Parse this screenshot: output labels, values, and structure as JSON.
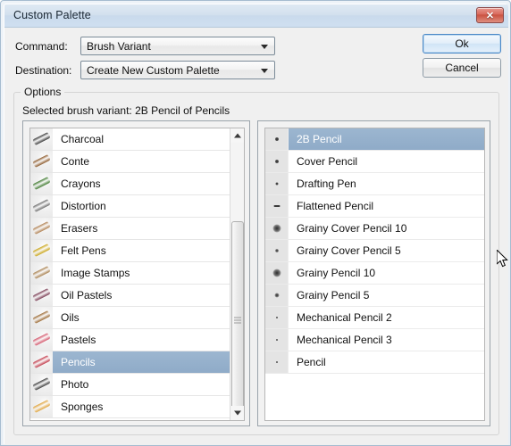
{
  "window": {
    "title": "Custom Palette",
    "close_icon": "close-x-icon",
    "close_label": "✕"
  },
  "form": {
    "command_label": "Command:",
    "command_value": "Brush Variant",
    "destination_label": "Destination:",
    "destination_value": "Create New Custom Palette"
  },
  "buttons": {
    "ok_label": "Ok",
    "cancel_label": "Cancel"
  },
  "options": {
    "group_title": "Options",
    "selected_variant_text": "Selected brush variant: 2B Pencil of Pencils"
  },
  "category_list": {
    "selected": "Pencils",
    "items": [
      {
        "label": "Charcoal",
        "thumb": "#3a3a3a"
      },
      {
        "label": "Conte",
        "thumb": "#8d5a2b"
      },
      {
        "label": "Crayons",
        "thumb": "#3f7a2e"
      },
      {
        "label": "Distortion",
        "thumb": "#6e6e6e"
      },
      {
        "label": "Erasers",
        "thumb": "#b08050"
      },
      {
        "label": "Felt Pens",
        "thumb": "#caa518"
      },
      {
        "label": "Image Stamps",
        "thumb": "#a9814f"
      },
      {
        "label": "Oil Pastels",
        "thumb": "#7a3b52"
      },
      {
        "label": "Oils",
        "thumb": "#9c6a33"
      },
      {
        "label": "Pastels",
        "thumb": "#d4556a"
      },
      {
        "label": "Pencils",
        "thumb": "#c23a4a"
      },
      {
        "label": "Photo",
        "thumb": "#3c3c3c"
      },
      {
        "label": "Sponges",
        "thumb": "#e0a43c"
      }
    ],
    "scrollbar": {
      "up_icon": "scroll-up-arrow-icon",
      "down_icon": "scroll-down-arrow-icon"
    }
  },
  "variant_list": {
    "selected": "2B Pencil",
    "items": [
      {
        "label": "2B Pencil",
        "dab": 4,
        "soft": false
      },
      {
        "label": "Cover Pencil",
        "dab": 4,
        "soft": false
      },
      {
        "label": "Drafting Pen",
        "dab": 3,
        "soft": false
      },
      {
        "label": "Flattened Pencil",
        "dab": 0,
        "soft": false
      },
      {
        "label": "Grainy Cover Pencil 10",
        "dab": 9,
        "soft": true
      },
      {
        "label": "Grainy Cover Pencil 5",
        "dab": 4,
        "soft": true
      },
      {
        "label": "Grainy Pencil 10",
        "dab": 9,
        "soft": true
      },
      {
        "label": "Grainy Pencil 5",
        "dab": 5,
        "soft": true
      },
      {
        "label": "Mechanical Pencil 2",
        "dab": 2,
        "soft": false
      },
      {
        "label": "Mechanical Pencil 3",
        "dab": 2,
        "soft": false
      },
      {
        "label": "Pencil",
        "dab": 2,
        "soft": false
      }
    ]
  }
}
